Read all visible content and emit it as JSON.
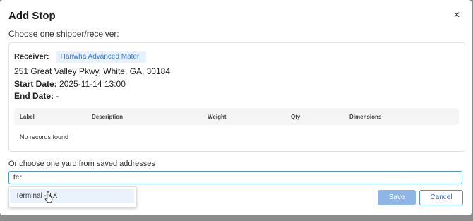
{
  "modal": {
    "title": "Add Stop",
    "close_symbol": "×",
    "subtitle": "Choose one shipper/receiver:"
  },
  "receiver": {
    "label": "Receiver:",
    "name": "Hanwha Advanced Materi",
    "address": "251 Great Valley Pkwy, White, GA, 30184",
    "start_label": "Start Date:",
    "start_value": "2025-11-14 13:00",
    "end_label": "End Date:",
    "end_value": "-"
  },
  "table": {
    "columns": [
      "Label",
      "Description",
      "Weight",
      "Qty",
      "Dimensions"
    ],
    "empty_text": "No records found"
  },
  "yard": {
    "label": "Or choose one yard from saved addresses",
    "search_value": "ter",
    "options": [
      "Terminal - TX"
    ]
  },
  "actions": {
    "save_label": "Save",
    "cancel_label": "Cancel"
  },
  "colors": {
    "accent": "#4a90e2",
    "badge_bg": "#e8f1fc",
    "save_disabled": "#8fb4e6"
  },
  "icons": {
    "close": "close-icon",
    "cursor": "hand-pointer-icon"
  }
}
